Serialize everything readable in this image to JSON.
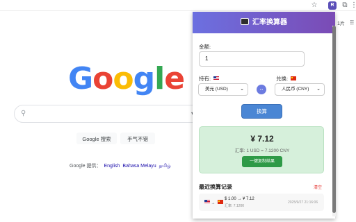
{
  "browser": {
    "extension_badge": "R",
    "icons": {
      "star": "star-icon",
      "extension": "extension-icon",
      "puzzle": "puzzle-icon",
      "menu": "kebab-icon"
    }
  },
  "google": {
    "logo_letters": [
      {
        "ch": "G",
        "color": "#4285F4"
      },
      {
        "ch": "o",
        "color": "#EA4335"
      },
      {
        "ch": "o",
        "color": "#FBBC05"
      },
      {
        "ch": "g",
        "color": "#4285F4"
      },
      {
        "ch": "l",
        "color": "#34A853"
      },
      {
        "ch": "e",
        "color": "#EA4335"
      }
    ],
    "search_button": "Google 搜索",
    "lucky_button": "手气不错",
    "lang_prefix": "Google 提供：",
    "languages": [
      "English",
      "Bahasa Melayu",
      "தமிழ்"
    ],
    "right_text": "1片"
  },
  "popup": {
    "title": "汇率换算器",
    "amount_label": "金额:",
    "amount_value": "1",
    "from_label": "持有:",
    "to_label": "兑换:",
    "from_currency": "美元 (USD)",
    "to_currency": "人民币 (CNY)",
    "swap_symbol": "↔",
    "convert_button": "换算",
    "result": {
      "amount": "¥ 7.12",
      "rate": "汇率: 1 USD = 7.1200 CNY",
      "copy_button": "一键复制结果"
    },
    "history": {
      "title": "最近换算记录",
      "clear": "清空",
      "items": [
        {
          "flags": "→",
          "conversion": "$ 1.00 → ¥ 7.12",
          "rate": "汇率: 7.1200",
          "time": "2025/9/27 21:16:06"
        }
      ]
    },
    "colors": {
      "header_start": "#6c70e0",
      "header_end": "#7b4bb5",
      "result_bg": "#d6f0db",
      "copy_button": "#2e9a47",
      "convert_button": "#4a86d4",
      "clear": "#e53935"
    }
  }
}
